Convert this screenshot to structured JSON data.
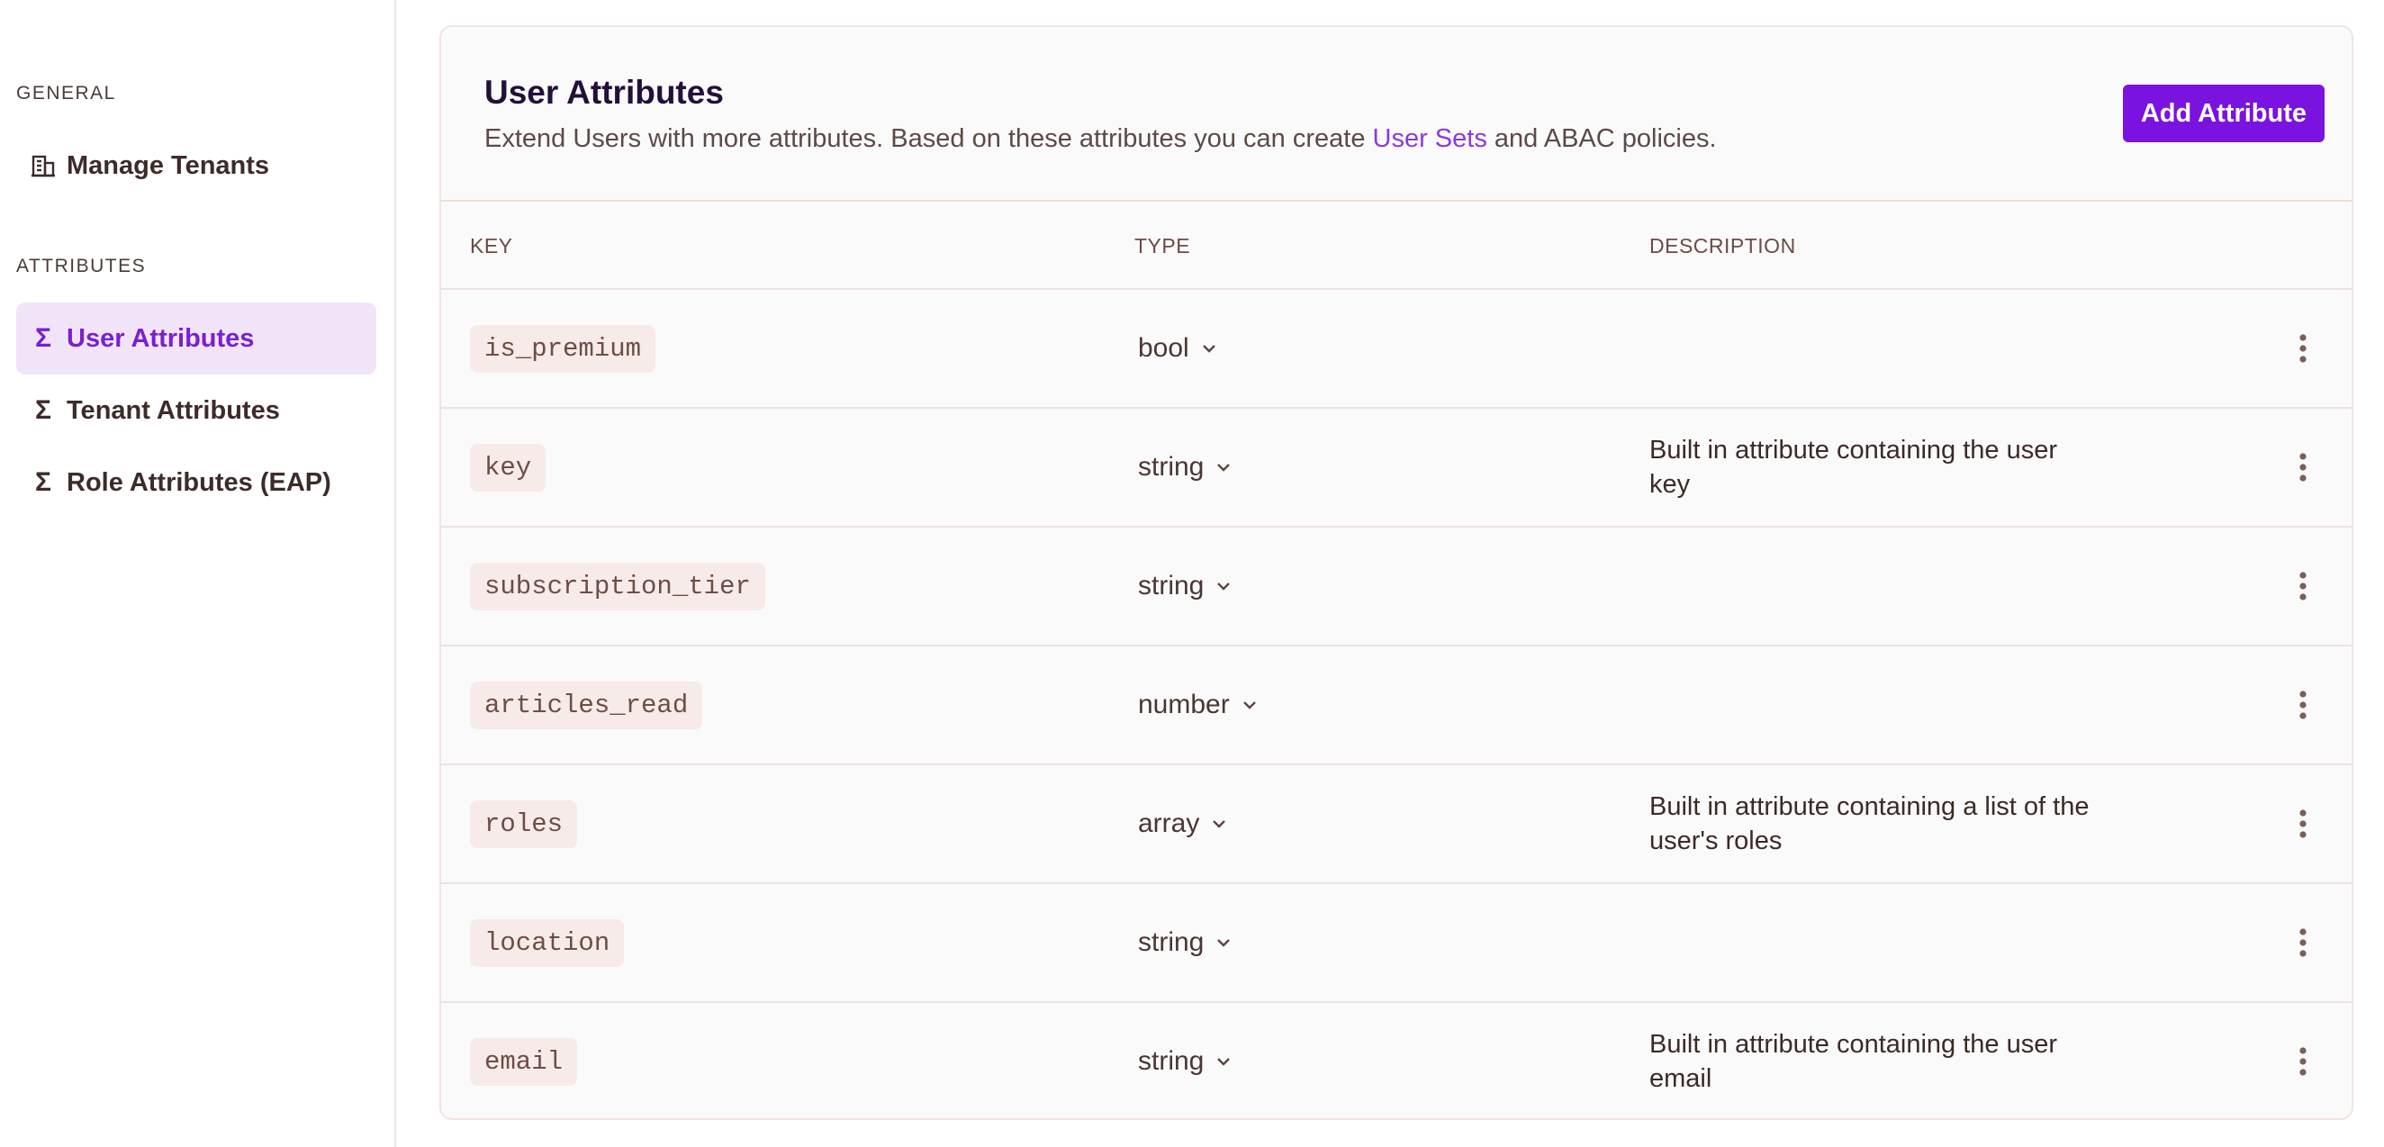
{
  "sidebar": {
    "general_label": "GENERAL",
    "attributes_label": "ATTRIBUTES",
    "items": [
      {
        "label": "Manage Tenants",
        "icon": "building-icon"
      },
      {
        "label": "User Attributes",
        "icon": "sigma-icon",
        "active": true
      },
      {
        "label": "Tenant Attributes",
        "icon": "sigma-icon"
      },
      {
        "label": "Role Attributes (EAP)",
        "icon": "sigma-icon"
      }
    ]
  },
  "card": {
    "title": "User Attributes",
    "subtitle_before": "Extend Users with more attributes. Based on these attributes you can create ",
    "subtitle_link": "User Sets",
    "subtitle_after": " and ABAC policies.",
    "add_button": "Add Attribute"
  },
  "table": {
    "headers": {
      "key": "KEY",
      "type": "TYPE",
      "description": "DESCRIPTION"
    },
    "rows": [
      {
        "key": "is_premium",
        "type": "bool",
        "description": ""
      },
      {
        "key": "key",
        "type": "string",
        "description": "Built in attribute containing the user key"
      },
      {
        "key": "subscription_tier",
        "type": "string",
        "description": ""
      },
      {
        "key": "articles_read",
        "type": "number",
        "description": ""
      },
      {
        "key": "roles",
        "type": "array",
        "description": "Built in attribute containing a list of the user's roles"
      },
      {
        "key": "location",
        "type": "string",
        "description": ""
      },
      {
        "key": "email",
        "type": "string",
        "description": "Built in attribute containing the user email"
      }
    ]
  },
  "colors": {
    "accent": "#7a13e0",
    "active_bg": "#f1e4f8",
    "link": "#8a3ae0"
  }
}
